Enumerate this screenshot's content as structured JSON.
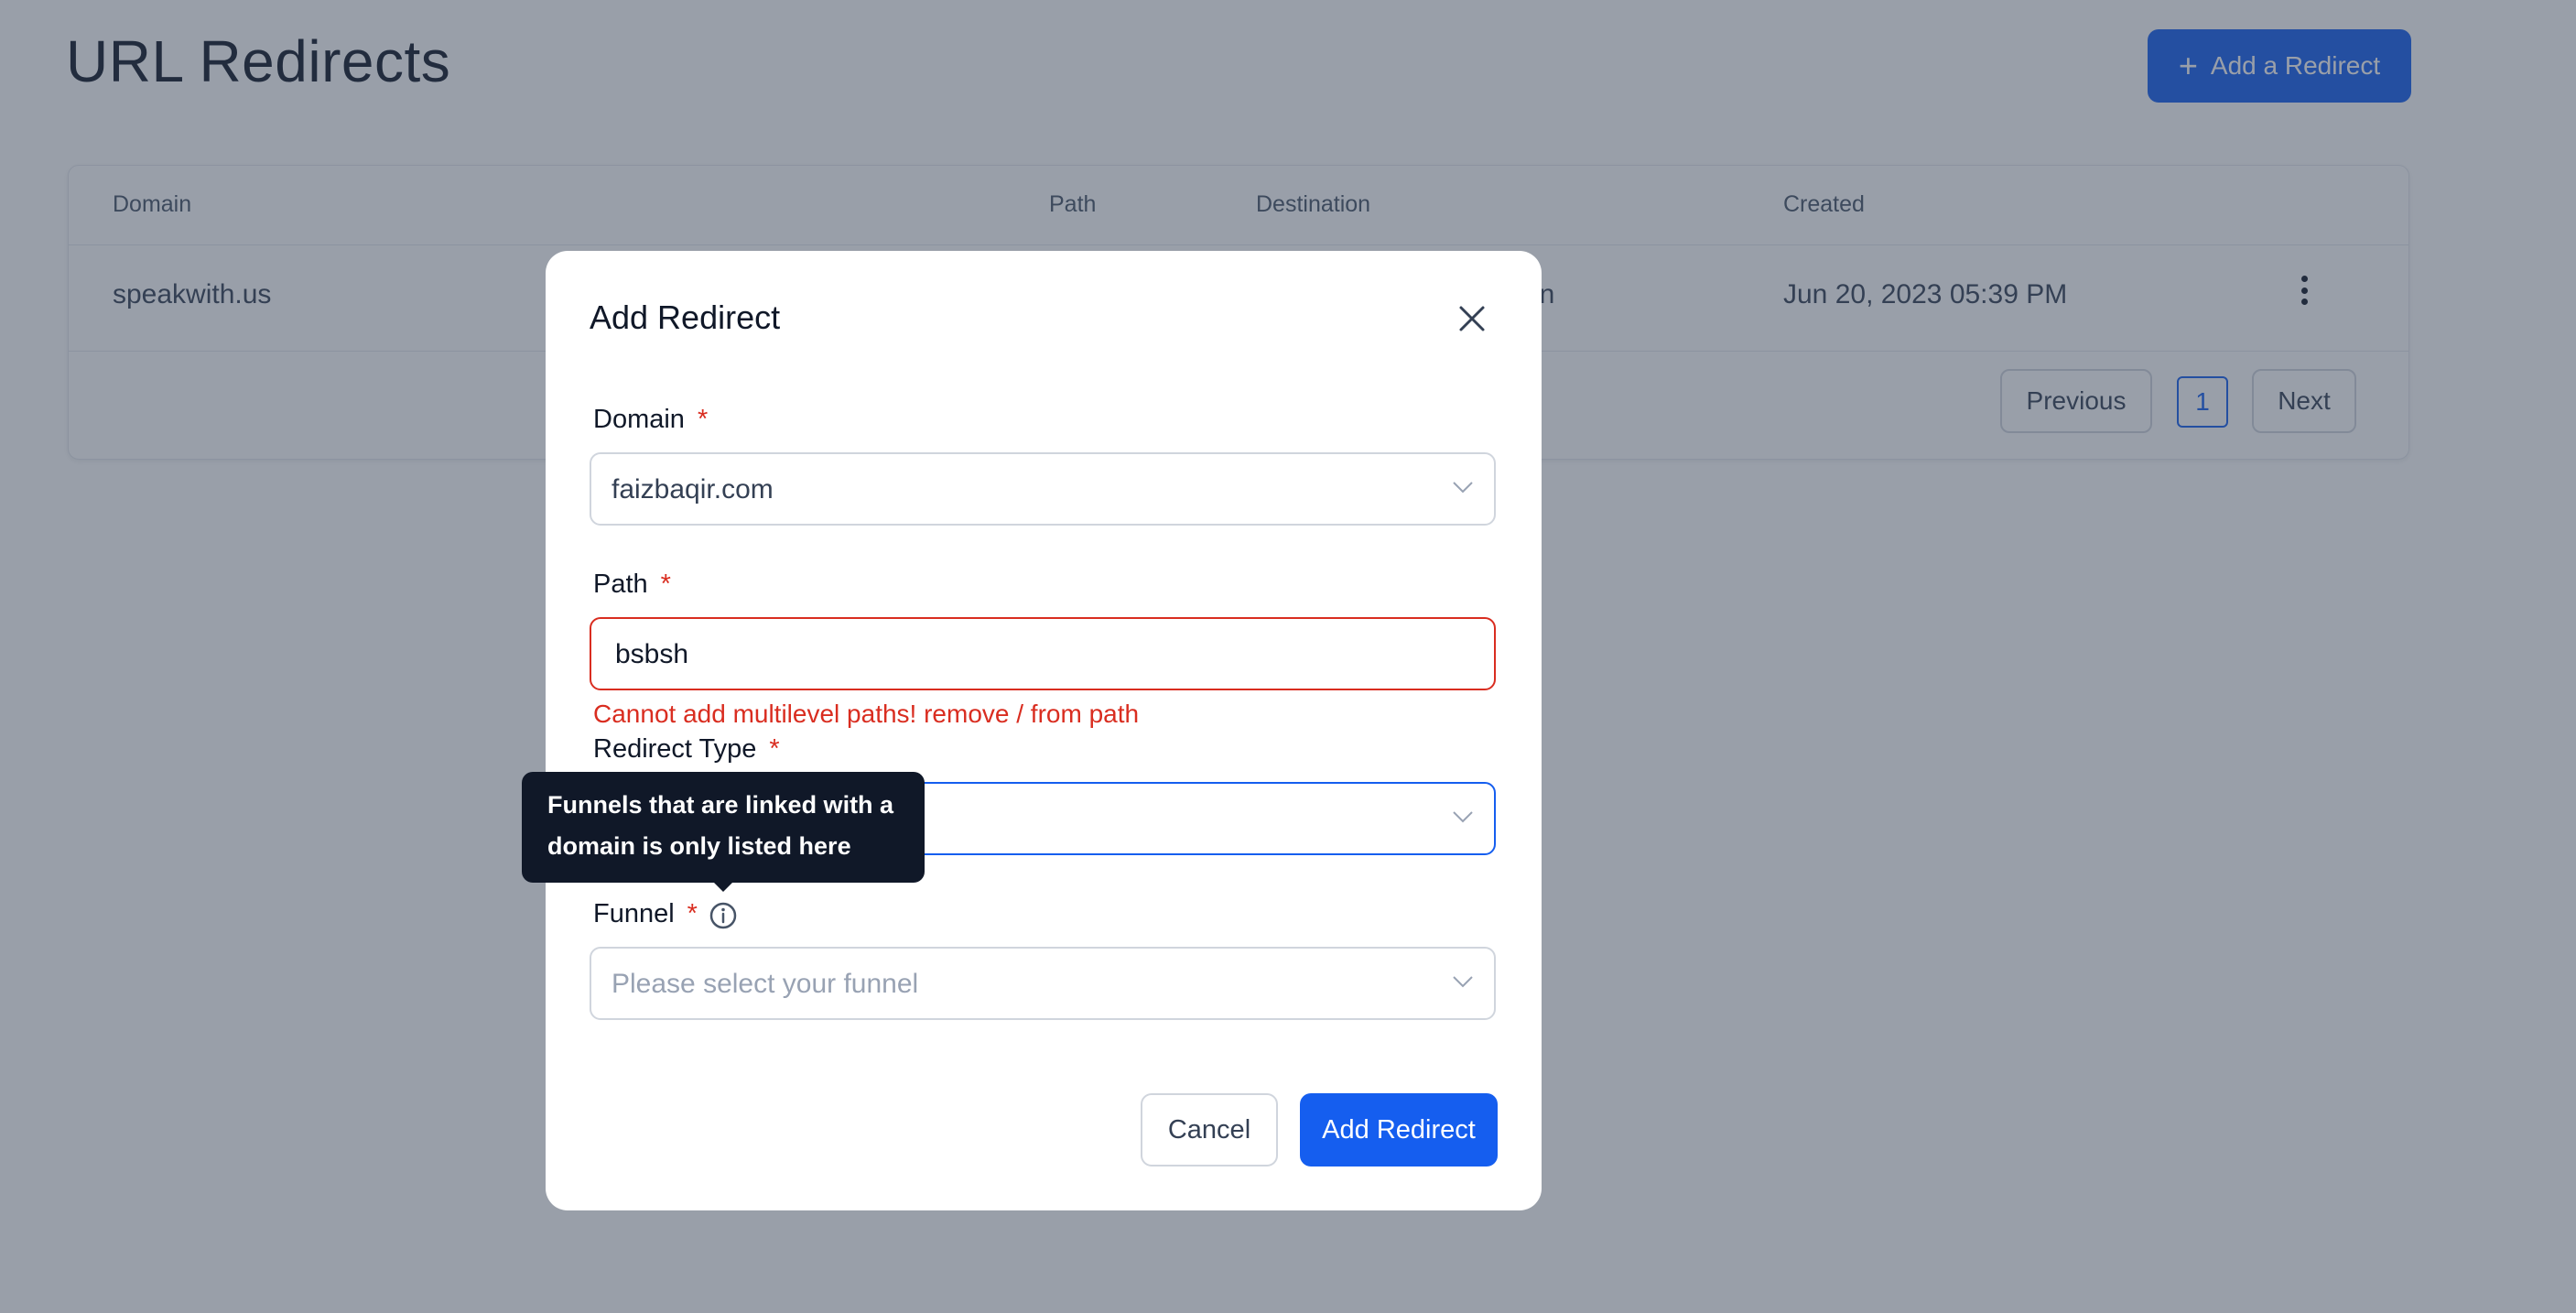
{
  "page": {
    "title": "URL Redirects",
    "add_button_label": "Add a Redirect"
  },
  "table": {
    "columns": [
      "Domain",
      "Path",
      "Destination",
      "Created"
    ],
    "rows": [
      {
        "domain": "speakwith.us",
        "destination_partial": "in",
        "created": "Jun 20, 2023 05:39 PM"
      }
    ],
    "pagination": {
      "previous": "Previous",
      "current_page": "1",
      "next": "Next"
    }
  },
  "modal": {
    "title": "Add Redirect",
    "domain": {
      "label": "Domain",
      "required_mark": "*",
      "value": "faizbaqir.com"
    },
    "path": {
      "label": "Path",
      "required_mark": "*",
      "value": "bsbsh",
      "error": "Cannot add multilevel paths! remove / from path"
    },
    "redirect_type": {
      "label": "Redirect Type",
      "required_mark": "*",
      "value": ""
    },
    "funnel": {
      "label": "Funnel",
      "required_mark": "*",
      "placeholder": "Please select your funnel"
    },
    "tooltip": "Funnels that are linked with a domain is only listed here",
    "cancel_label": "Cancel",
    "submit_label": "Add Redirect"
  },
  "colors": {
    "primary": "#155eef",
    "error": "#d92d20",
    "overlay": "rgba(52,64,84,0.5)",
    "tooltip_bg": "#101828"
  },
  "icons": [
    "plus-icon",
    "kebab-menu-icon",
    "close-icon",
    "chevron-down-icon",
    "info-icon"
  ]
}
